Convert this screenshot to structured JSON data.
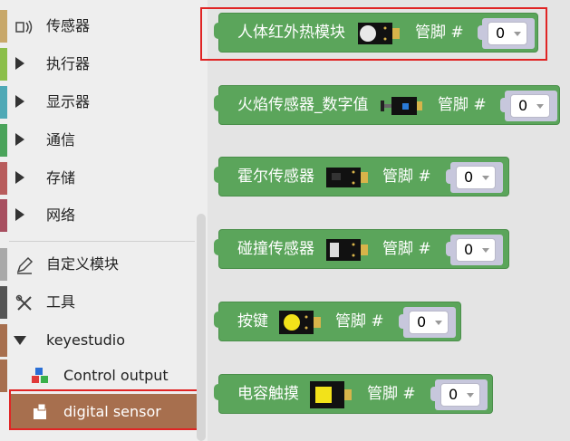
{
  "sidebar": {
    "categories": [
      {
        "label": "传感器",
        "color": "#c8a86a"
      },
      {
        "label": "执行器",
        "color": "#8bbf4a"
      },
      {
        "label": "显示器",
        "color": "#4fa9b6"
      },
      {
        "label": "通信",
        "color": "#4aa35a"
      },
      {
        "label": "存储",
        "color": "#b85c5c"
      },
      {
        "label": "网络",
        "color": "#a84f60"
      },
      {
        "label": "自定义模块",
        "color": "#a9a9a9"
      },
      {
        "label": "工具",
        "color": "#555555"
      },
      {
        "label": "keyestudio",
        "color": "#a76f4e"
      }
    ],
    "subcategories": [
      {
        "label": "Control output"
      },
      {
        "label": "digital sensor"
      }
    ]
  },
  "blocks": [
    {
      "title": "人体红外热模块",
      "pin_label": "管脚 #",
      "pin_value": "0",
      "icon": "pir-sensor-icon"
    },
    {
      "title": "火焰传感器_数字值",
      "pin_label": "管脚 #",
      "pin_value": "0",
      "icon": "flame-sensor-icon"
    },
    {
      "title": "霍尔传感器",
      "pin_label": "管脚 #",
      "pin_value": "0",
      "icon": "hall-sensor-icon"
    },
    {
      "title": "碰撞传感器",
      "pin_label": "管脚 #",
      "pin_value": "0",
      "icon": "crash-sensor-icon"
    },
    {
      "title": "按键",
      "pin_label": "管脚 #",
      "pin_value": "0",
      "icon": "button-module-icon"
    },
    {
      "title": "电容触摸",
      "pin_label": "管脚 #",
      "pin_value": "0",
      "icon": "touch-sensor-icon"
    }
  ]
}
